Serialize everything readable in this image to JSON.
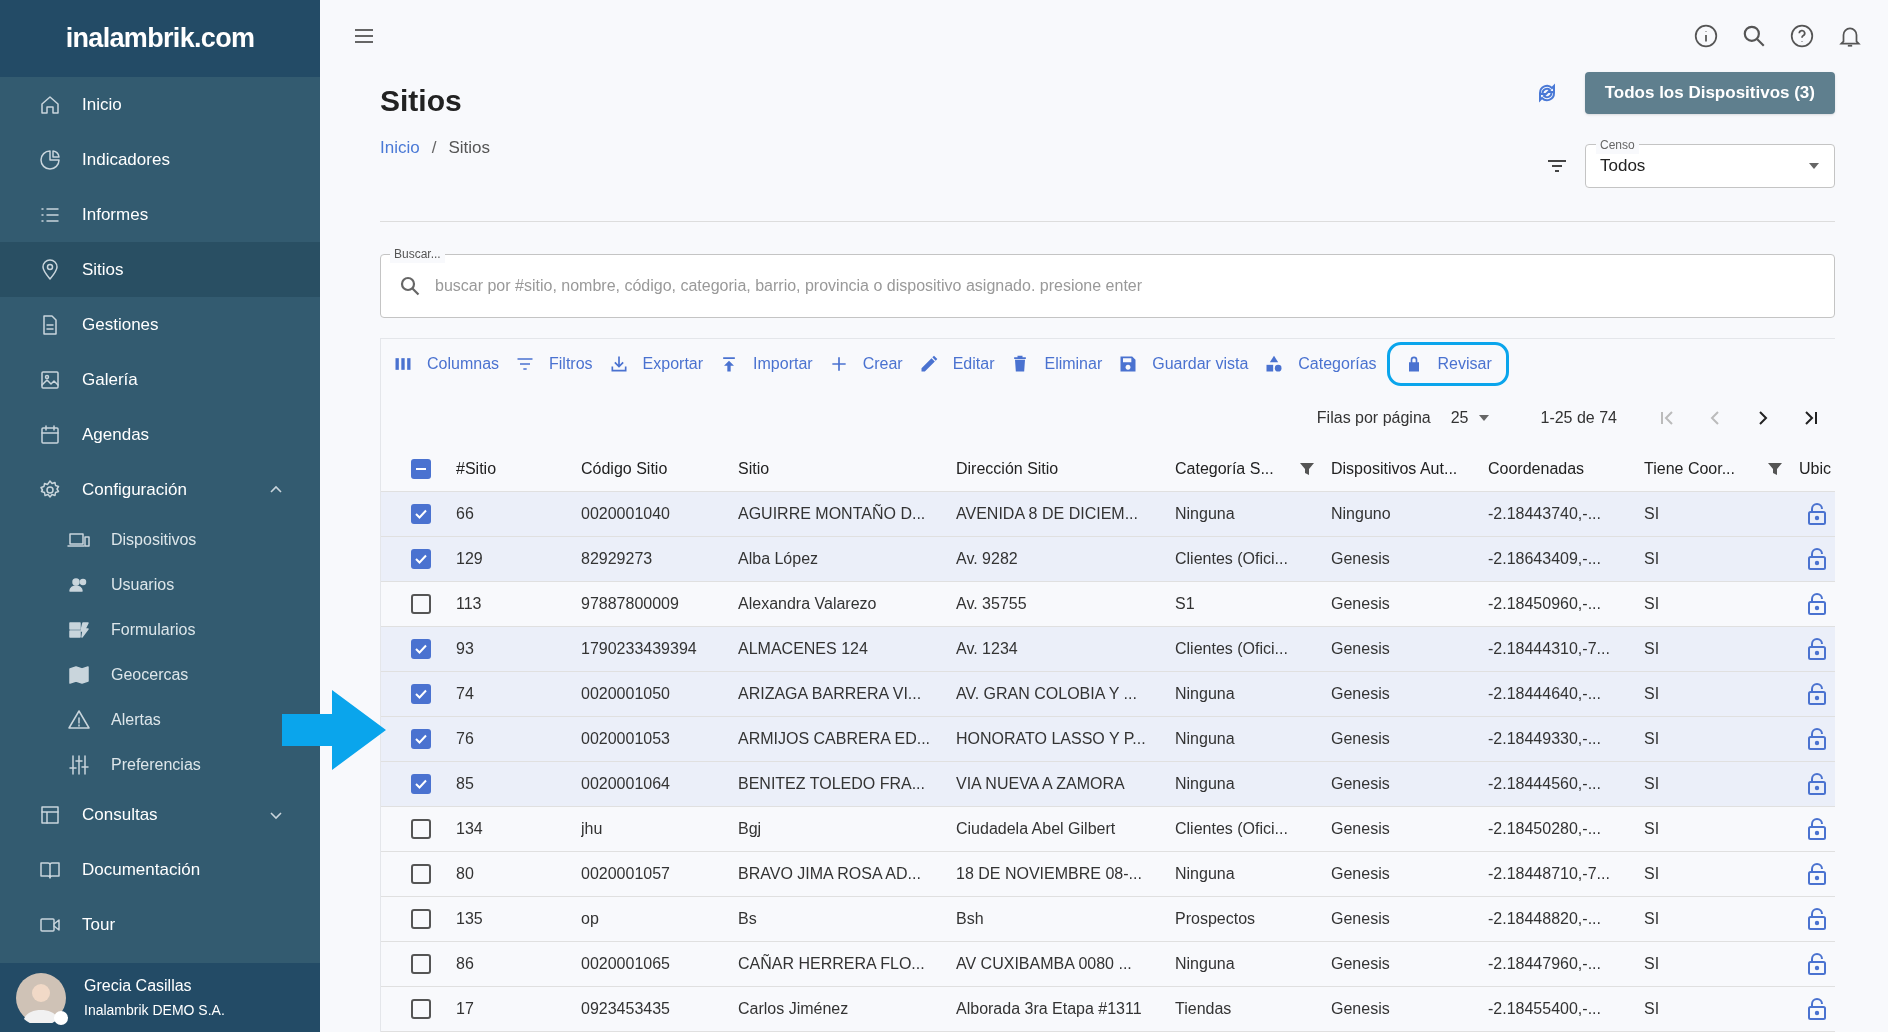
{
  "sidebar": {
    "logo": "inalambrik.com",
    "items": [
      {
        "label": "Inicio",
        "selected": false
      },
      {
        "label": "Indicadores",
        "selected": false
      },
      {
        "label": "Informes",
        "selected": false
      },
      {
        "label": "Sitios",
        "selected": true
      },
      {
        "label": "Gestiones",
        "selected": false
      },
      {
        "label": "Galería",
        "selected": false
      },
      {
        "label": "Agendas",
        "selected": false
      },
      {
        "label": "Configuración",
        "selected": false,
        "expanded": true,
        "children": [
          {
            "label": "Dispositivos"
          },
          {
            "label": "Usuarios"
          },
          {
            "label": "Formularios"
          },
          {
            "label": "Geocercas"
          },
          {
            "label": "Alertas"
          },
          {
            "label": "Preferencias"
          }
        ]
      },
      {
        "label": "Consultas",
        "selected": false,
        "expanded": false
      },
      {
        "label": "Documentación",
        "selected": false
      },
      {
        "label": "Tour",
        "selected": false
      }
    ],
    "user": {
      "name": "Grecia Casillas",
      "company": "Inalambrik DEMO S.A."
    }
  },
  "page": {
    "title": "Sitios",
    "breadcrumb": [
      "Inicio",
      "/",
      "Sitios"
    ],
    "devices_button": "Todos los Dispositivos (3)",
    "censo": {
      "label": "Censo",
      "value": "Todos"
    }
  },
  "search": {
    "label": "Buscar...",
    "placeholder": "buscar por #sitio, nombre, código, categoria, barrio, provincia o dispositivo asignado. presione enter"
  },
  "toolbar": [
    {
      "label": "Columnas",
      "highlighted": false
    },
    {
      "label": "Filtros",
      "highlighted": false
    },
    {
      "label": "Exportar",
      "highlighted": false
    },
    {
      "label": "Importar",
      "highlighted": false
    },
    {
      "label": "Crear",
      "highlighted": false
    },
    {
      "label": "Editar",
      "highlighted": false
    },
    {
      "label": "Eliminar",
      "highlighted": false
    },
    {
      "label": "Guardar vista",
      "highlighted": false
    },
    {
      "label": "Categorías",
      "highlighted": false
    },
    {
      "label": "Revisar",
      "highlighted": true
    }
  ],
  "pagination": {
    "rows_label": "Filas por página",
    "rows_value": "25",
    "range": "1-25 de 74"
  },
  "table": {
    "select_all": {
      "checked": true,
      "partial": true
    },
    "columns": [
      {
        "label": "#Sitio",
        "filter": false
      },
      {
        "label": "Código Sitio",
        "filter": false
      },
      {
        "label": "Sitio",
        "filter": false
      },
      {
        "label": "Dirección Sitio",
        "filter": false
      },
      {
        "label": "Categoría S...",
        "filter": true
      },
      {
        "label": "Dispositivos Aut...",
        "filter": false
      },
      {
        "label": "Coordenadas",
        "filter": false
      },
      {
        "label": "Tiene Coor...",
        "filter": true
      },
      {
        "label": "Ubic"
      }
    ],
    "rows": [
      {
        "selected": true,
        "cells": [
          "66",
          "0020001040",
          "AGUIRRE MONTAÑO D...",
          "AVENIDA 8 DE DICIEM...",
          "Ninguna",
          "Ninguno",
          "-2.18443740,-...",
          "SI"
        ]
      },
      {
        "selected": true,
        "cells": [
          "129",
          "82929273",
          "Alba López",
          "Av. 9282",
          "Clientes (Ofici...",
          "Genesis",
          "-2.18643409,-...",
          "SI"
        ]
      },
      {
        "selected": false,
        "cells": [
          "113",
          "97887800009",
          "Alexandra Valarezo",
          "Av. 35755",
          "S1",
          "Genesis",
          "-2.18450960,-...",
          "SI"
        ]
      },
      {
        "selected": true,
        "cells": [
          "93",
          "1790233439394",
          "ALMACENES 124",
          "Av. 1234",
          "Clientes (Ofici...",
          "Genesis",
          "-2.18444310,-7...",
          "SI"
        ]
      },
      {
        "selected": true,
        "cells": [
          "74",
          "0020001050",
          "ARIZAGA BARRERA VI...",
          "AV. GRAN COLOBIA Y ...",
          "Ninguna",
          "Genesis",
          "-2.18444640,-...",
          "SI"
        ]
      },
      {
        "selected": true,
        "cells": [
          "76",
          "0020001053",
          "ARMIJOS CABRERA ED...",
          "HONORATO LASSO Y P...",
          "Ninguna",
          "Genesis",
          "-2.18449330,-...",
          "SI"
        ]
      },
      {
        "selected": true,
        "cells": [
          "85",
          "0020001064",
          "BENITEZ TOLEDO FRA...",
          "VIA NUEVA A ZAMORA",
          "Ninguna",
          "Genesis",
          "-2.18444560,-...",
          "SI"
        ]
      },
      {
        "selected": false,
        "cells": [
          "134",
          "jhu",
          "Bgj",
          "Ciudadela Abel Gilbert",
          "Clientes (Ofici...",
          "Genesis",
          "-2.18450280,-...",
          "SI"
        ]
      },
      {
        "selected": false,
        "cells": [
          "80",
          "0020001057",
          "BRAVO JIMA ROSA AD...",
          "18 DE NOVIEMBRE 08-...",
          "Ninguna",
          "Genesis",
          "-2.18448710,-7...",
          "SI"
        ]
      },
      {
        "selected": false,
        "cells": [
          "135",
          "op",
          "Bs",
          "Bsh",
          "Prospectos",
          "Genesis",
          "-2.18448820,-...",
          "SI"
        ]
      },
      {
        "selected": false,
        "cells": [
          "86",
          "0020001065",
          "CAÑAR HERRERA FLO...",
          "AV CUXIBAMBA 0080 ...",
          "Ninguna",
          "Genesis",
          "-2.18447960,-...",
          "SI"
        ]
      },
      {
        "selected": false,
        "cells": [
          "17",
          "0923453435",
          "Carlos Jiménez",
          "Alborada 3ra Etapa #1311",
          "Tiendas",
          "Genesis",
          "-2.18455400,-...",
          "SI"
        ]
      }
    ]
  }
}
